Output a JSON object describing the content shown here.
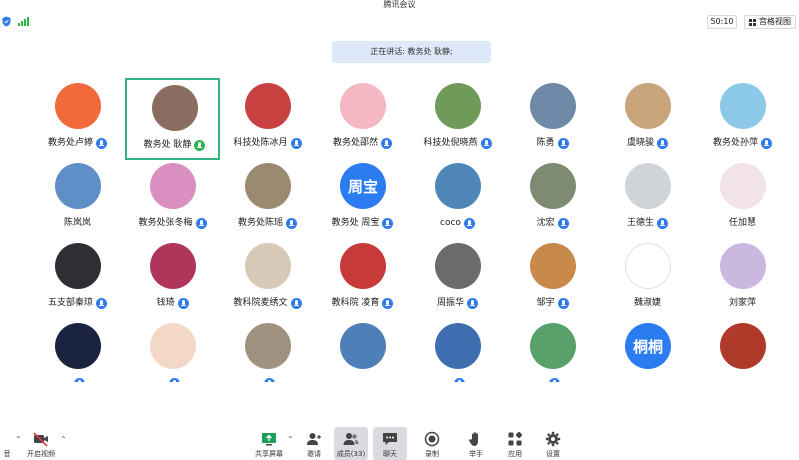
{
  "window": {
    "title": "腾讯会议"
  },
  "topbar": {
    "timer": "50:10",
    "view_button": "宫格视图"
  },
  "banner": {
    "speaking": "正在讲话: 教务处 耿静;"
  },
  "participants": [
    {
      "name": "教务处卢婷",
      "mic": "on",
      "avatar_color": "#f06a3c",
      "avatar_text": ""
    },
    {
      "name": "教务处 耿静",
      "mic": "speaking",
      "avatar_color": "#8a6d60",
      "avatar_text": "",
      "active": true
    },
    {
      "name": "科技处陈冰月",
      "mic": "on",
      "avatar_color": "#c94040",
      "avatar_text": ""
    },
    {
      "name": "教务处邵然",
      "mic": "on",
      "avatar_color": "#f5b7c4",
      "avatar_text": ""
    },
    {
      "name": "科技处倪晓燕",
      "mic": "on",
      "avatar_color": "#6f9a5a",
      "avatar_text": ""
    },
    {
      "name": "陈勇",
      "mic": "on",
      "avatar_color": "#6e8aa8",
      "avatar_text": ""
    },
    {
      "name": "虞晓骏",
      "mic": "on",
      "avatar_color": "#c9a47a",
      "avatar_text": ""
    },
    {
      "name": "教务处孙萍",
      "mic": "on",
      "avatar_color": "#8cc8e8",
      "avatar_text": ""
    },
    {
      "name": "陈岚岚",
      "mic": "none",
      "avatar_color": "#5f8fc6",
      "avatar_text": ""
    },
    {
      "name": "教务处张冬梅",
      "mic": "on",
      "avatar_color": "#d98fbf",
      "avatar_text": ""
    },
    {
      "name": "教务处陈瑶",
      "mic": "on",
      "avatar_color": "#9a8a70",
      "avatar_text": ""
    },
    {
      "name": "教务处 周宝",
      "mic": "on",
      "avatar_color": "#2a7cf0",
      "avatar_text": "周宝"
    },
    {
      "name": "coco",
      "mic": "on",
      "avatar_color": "#4f86b8",
      "avatar_text": ""
    },
    {
      "name": "沈宏",
      "mic": "on",
      "avatar_color": "#7e8b72",
      "avatar_text": ""
    },
    {
      "name": "王德生",
      "mic": "on",
      "avatar_color": "#d0d3d8",
      "avatar_text": ""
    },
    {
      "name": "任加慧",
      "mic": "none",
      "avatar_color": "#f2e3e6",
      "avatar_text": ""
    },
    {
      "name": "五支部秦琼",
      "mic": "on",
      "avatar_color": "#2d2f35",
      "avatar_text": ""
    },
    {
      "name": "钱琦",
      "mic": "on",
      "avatar_color": "#b0355a",
      "avatar_text": ""
    },
    {
      "name": "教科院麦绣文",
      "mic": "on",
      "avatar_color": "#d8c8b8",
      "avatar_text": ""
    },
    {
      "name": "教科院 凌育",
      "mic": "on",
      "avatar_color": "#c73a3a",
      "avatar_text": ""
    },
    {
      "name": "周振华",
      "mic": "on",
      "avatar_color": "#6b6b6b",
      "avatar_text": ""
    },
    {
      "name": "邹宇",
      "mic": "on",
      "avatar_color": "#c88a4a",
      "avatar_text": ""
    },
    {
      "name": "魏淑婕",
      "mic": "none",
      "avatar_color": "#ffffff",
      "avatar_text": ""
    },
    {
      "name": "刘家萍",
      "mic": "none",
      "avatar_color": "#cbb8e0",
      "avatar_text": ""
    },
    {
      "name": "",
      "mic": "on",
      "avatar_color": "#1a2340",
      "avatar_text": ""
    },
    {
      "name": "",
      "mic": "on",
      "avatar_color": "#f3d8c8",
      "avatar_text": ""
    },
    {
      "name": "",
      "mic": "on",
      "avatar_color": "#a09080",
      "avatar_text": ""
    },
    {
      "name": "",
      "mic": "none",
      "avatar_color": "#4f7fb8",
      "avatar_text": ""
    },
    {
      "name": "",
      "mic": "on",
      "avatar_color": "#3f6fb0",
      "avatar_text": ""
    },
    {
      "name": "",
      "mic": "on",
      "avatar_color": "#5aa06a",
      "avatar_text": ""
    },
    {
      "name": "",
      "mic": "none",
      "avatar_color": "#2a7cf0",
      "avatar_text": "桐桐"
    },
    {
      "name": "",
      "mic": "none",
      "avatar_color": "#b03a2a",
      "avatar_text": ""
    }
  ],
  "toolbar": {
    "audio_label": "音",
    "video_label": "开启视频",
    "share_label": "共享屏幕",
    "invite_label": "邀请",
    "members_label": "成员(33)",
    "chat_label": "聊天",
    "record_label": "录制",
    "hand_label": "举手",
    "apps_label": "应用",
    "settings_label": "设置"
  }
}
